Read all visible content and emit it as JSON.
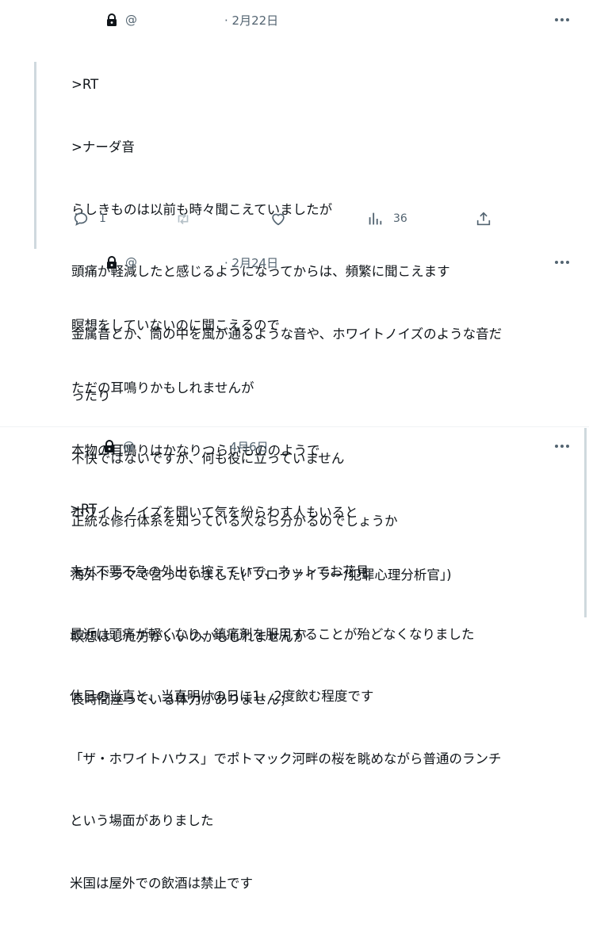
{
  "tweets": [
    {
      "handle": "@",
      "date": "· 2月22日",
      "lines": [
        ">RT",
        ">ナーダ音",
        "らしきものは以前も時々聞こえていましたが",
        "頭痛が軽減したと感じるようになってからは、頻繁に聞こえます",
        "金属音とか、筒の中を風が通るような音や、ホワイトノイズのような音だ",
        "ったり",
        "不快ではないですが、何も役に立っていません",
        "正統な修行体系を知っている人なら分かるのでしょうか"
      ],
      "reply_count": "1",
      "view_count": "36"
    },
    {
      "handle": "@",
      "date": "· 2月24日",
      "lines": [
        "瞑想をしていないのに聞こえるので",
        "ただの耳鳴りかもしれませんが",
        "本物の耳鳴りはかなりつらいもののようで",
        "ホワイトノイズを聞いて気を紛らわす人もいると",
        "海外ドラマで言っていました(「プロファイラー/犯罪心理分析官」)",
        "瞑想はした方がいいのかもしれませんが",
        "長時間座っている体力がありません；"
      ]
    },
    {
      "handle": "@",
      "date": "· 4月6日",
      "lines": [
        ">RT",
        "未だ不要不急の外出を控えていて、ネットでお花見",
        "最近は頭痛が軽くなり、鎮痛剤を服用することが殆どなくなりました",
        "休日の当直と、当直明けの日に1、2度飲む程度です",
        "「ザ・ホワイトハウス」でポトマック河畔の桜を眺めながら普通のランチ",
        "という場面がありました",
        "米国は屋外での飲酒は禁止です"
      ]
    }
  ]
}
